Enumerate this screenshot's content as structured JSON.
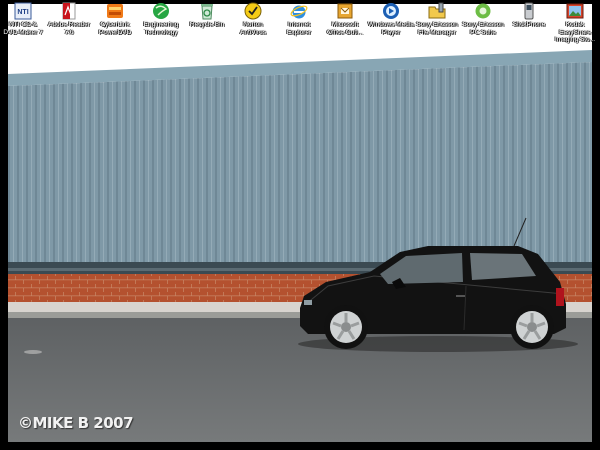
{
  "desktop": {
    "icons": [
      {
        "label": "NTI CD &\nDVD-Maker 7",
        "icon": "nti-disc-icon"
      },
      {
        "label": "Adobe Reader\n7.0",
        "icon": "adobe-reader-icon"
      },
      {
        "label": "CyberLink\nPowerDVD",
        "icon": "powerdvd-icon"
      },
      {
        "label": "Engineering\nTechnology",
        "icon": "engineering-globe-icon"
      },
      {
        "label": "Recycle Bin",
        "icon": "recycle-bin-icon"
      },
      {
        "label": "Norton\nAntiVirus",
        "icon": "norton-antivirus-icon"
      },
      {
        "label": "Internet\nExplorer",
        "icon": "internet-explorer-icon"
      },
      {
        "label": "Microsoft\nOffice Outl...",
        "icon": "outlook-icon"
      },
      {
        "label": "Windows Media\nPlayer",
        "icon": "media-player-icon"
      },
      {
        "label": "Sony Ericsson\nFile Manager",
        "icon": "file-manager-icon"
      },
      {
        "label": "Sony Ericsson\nPC Suite",
        "icon": "pc-suite-icon"
      },
      {
        "label": "SlickPhone",
        "icon": "phone-icon"
      },
      {
        "label": "Kodak EasyShare\nImaging Sto...",
        "icon": "imaging-icon"
      }
    ],
    "wallpaper": {
      "credit": "©MIKE B 2007",
      "colors": {
        "cladding": "#7e98a6",
        "brick": "#b5502e",
        "asphalt": "#6b6e70",
        "car": "#141414"
      }
    }
  }
}
